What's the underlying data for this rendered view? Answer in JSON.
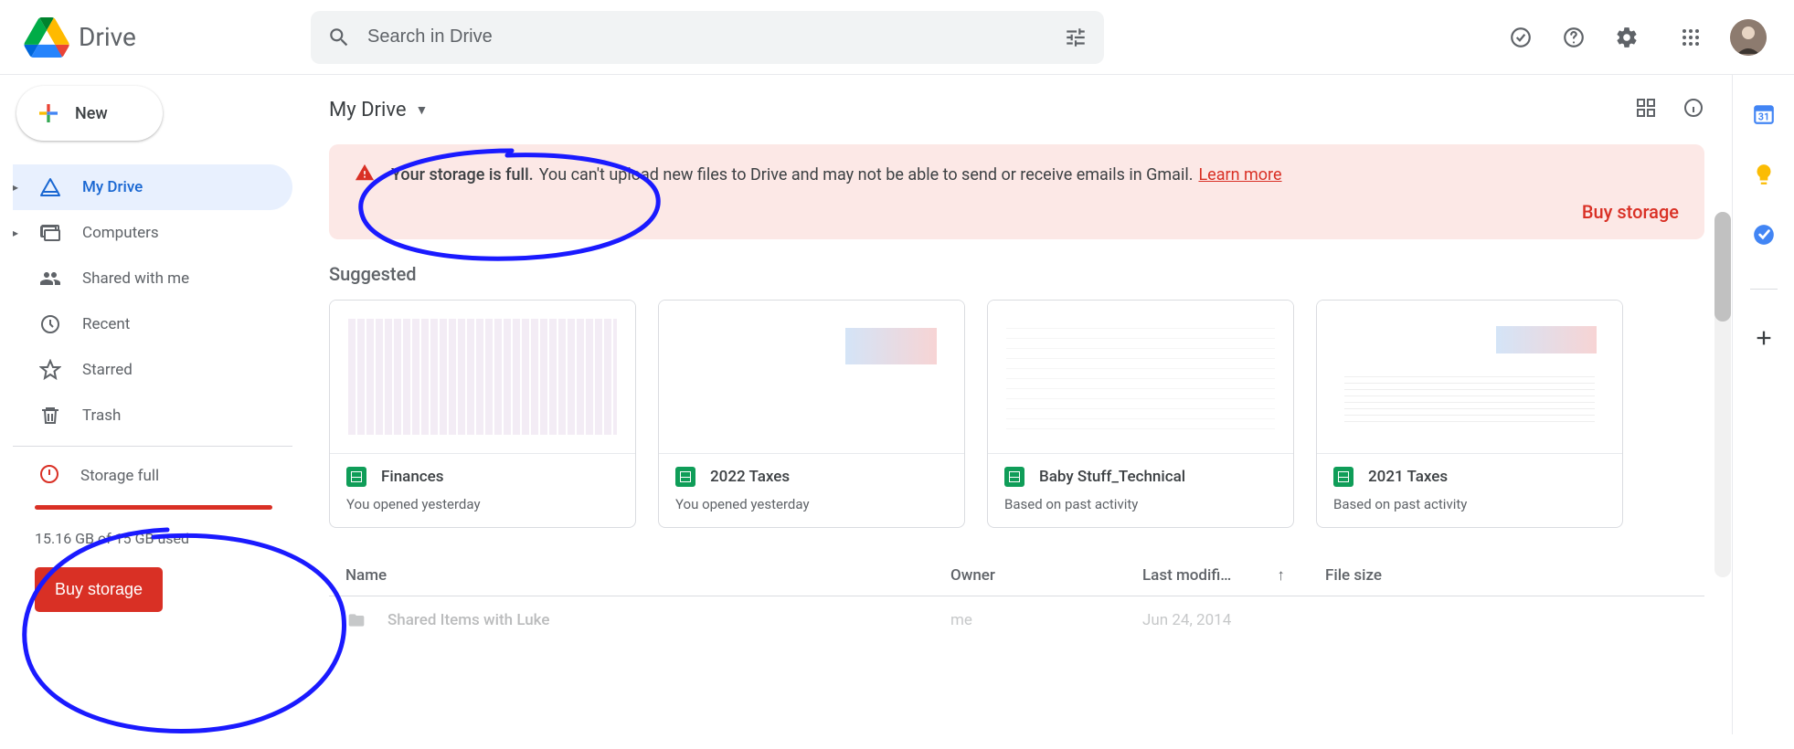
{
  "app": {
    "name": "Drive"
  },
  "search": {
    "placeholder": "Search in Drive"
  },
  "new_button": {
    "label": "New"
  },
  "nav": {
    "my_drive": "My Drive",
    "computers": "Computers",
    "shared": "Shared with me",
    "recent": "Recent",
    "starred": "Starred",
    "trash": "Trash"
  },
  "storage": {
    "label": "Storage full",
    "used_text": "15.16 GB of 15 GB used",
    "buy_label": "Buy storage"
  },
  "breadcrumb": {
    "title": "My Drive"
  },
  "banner": {
    "strong": "Your storage is full.",
    "text": "You can't upload new files to Drive and may not be able to send or receive emails in Gmail.",
    "learn_more": "Learn more",
    "buy": "Buy storage"
  },
  "suggested": {
    "title": "Suggested",
    "cards": [
      {
        "title": "Finances",
        "sub": "You opened yesterday"
      },
      {
        "title": "2022 Taxes",
        "sub": "You opened yesterday"
      },
      {
        "title": "Baby Stuff_Technical",
        "sub": "Based on past activity"
      },
      {
        "title": "2021 Taxes",
        "sub": "Based on past activity"
      }
    ]
  },
  "table": {
    "headers": {
      "name": "Name",
      "owner": "Owner",
      "modified": "Last modifi…",
      "size": "File size"
    },
    "rows": [
      {
        "name": "Shared Items with Luke",
        "owner": "me",
        "modified": "Jun 24, 2014",
        "size": ""
      }
    ]
  }
}
